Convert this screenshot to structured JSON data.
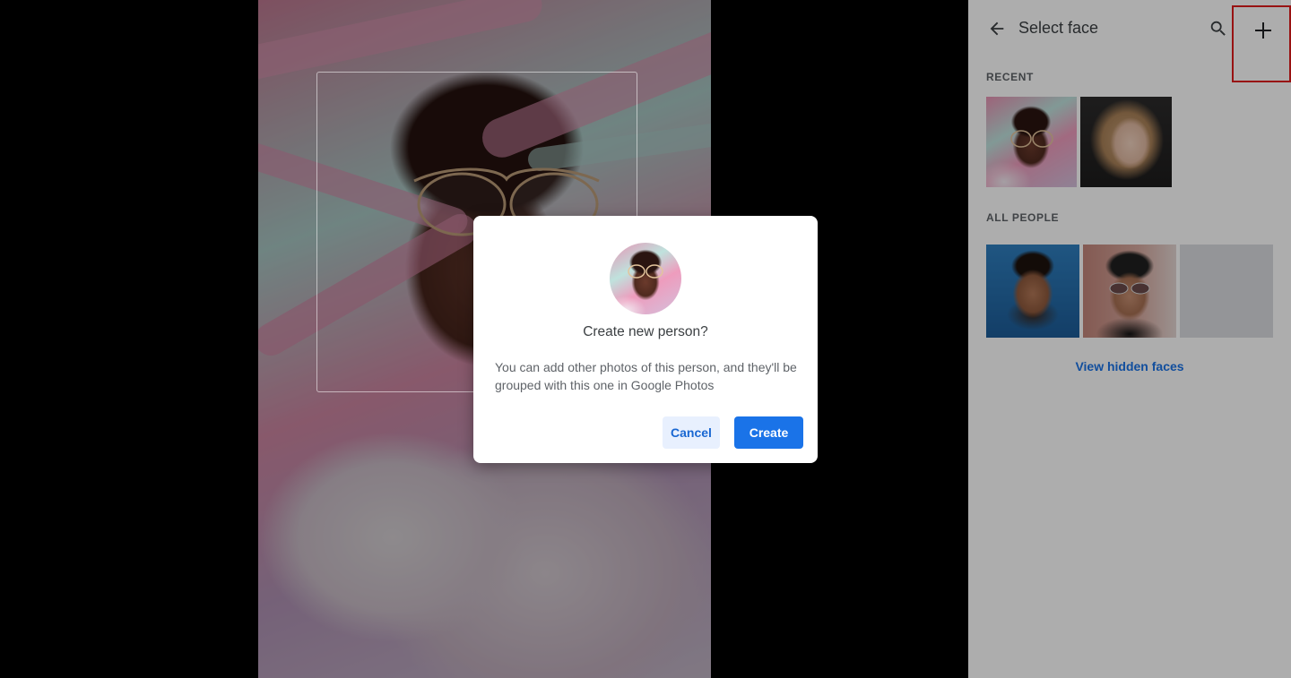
{
  "viewer": {
    "photo_alt": "",
    "face_box_visible": true
  },
  "panel": {
    "title": "Select face",
    "icons": {
      "back": "arrow-back-icon",
      "search": "search-icon",
      "add": "plus-icon"
    },
    "recent_label": "RECENT",
    "all_people_label": "ALL PEOPLE",
    "view_hidden_label": "View hidden faces"
  },
  "dialog": {
    "title": "Create new person?",
    "body": "You can add other photos of this person, and they'll be grouped with this one in Google Photos",
    "cancel_label": "Cancel",
    "create_label": "Create"
  },
  "colors": {
    "accent": "#1a73e8",
    "accent_light": "#e8f0fe",
    "highlight_border": "#e01b1b"
  }
}
